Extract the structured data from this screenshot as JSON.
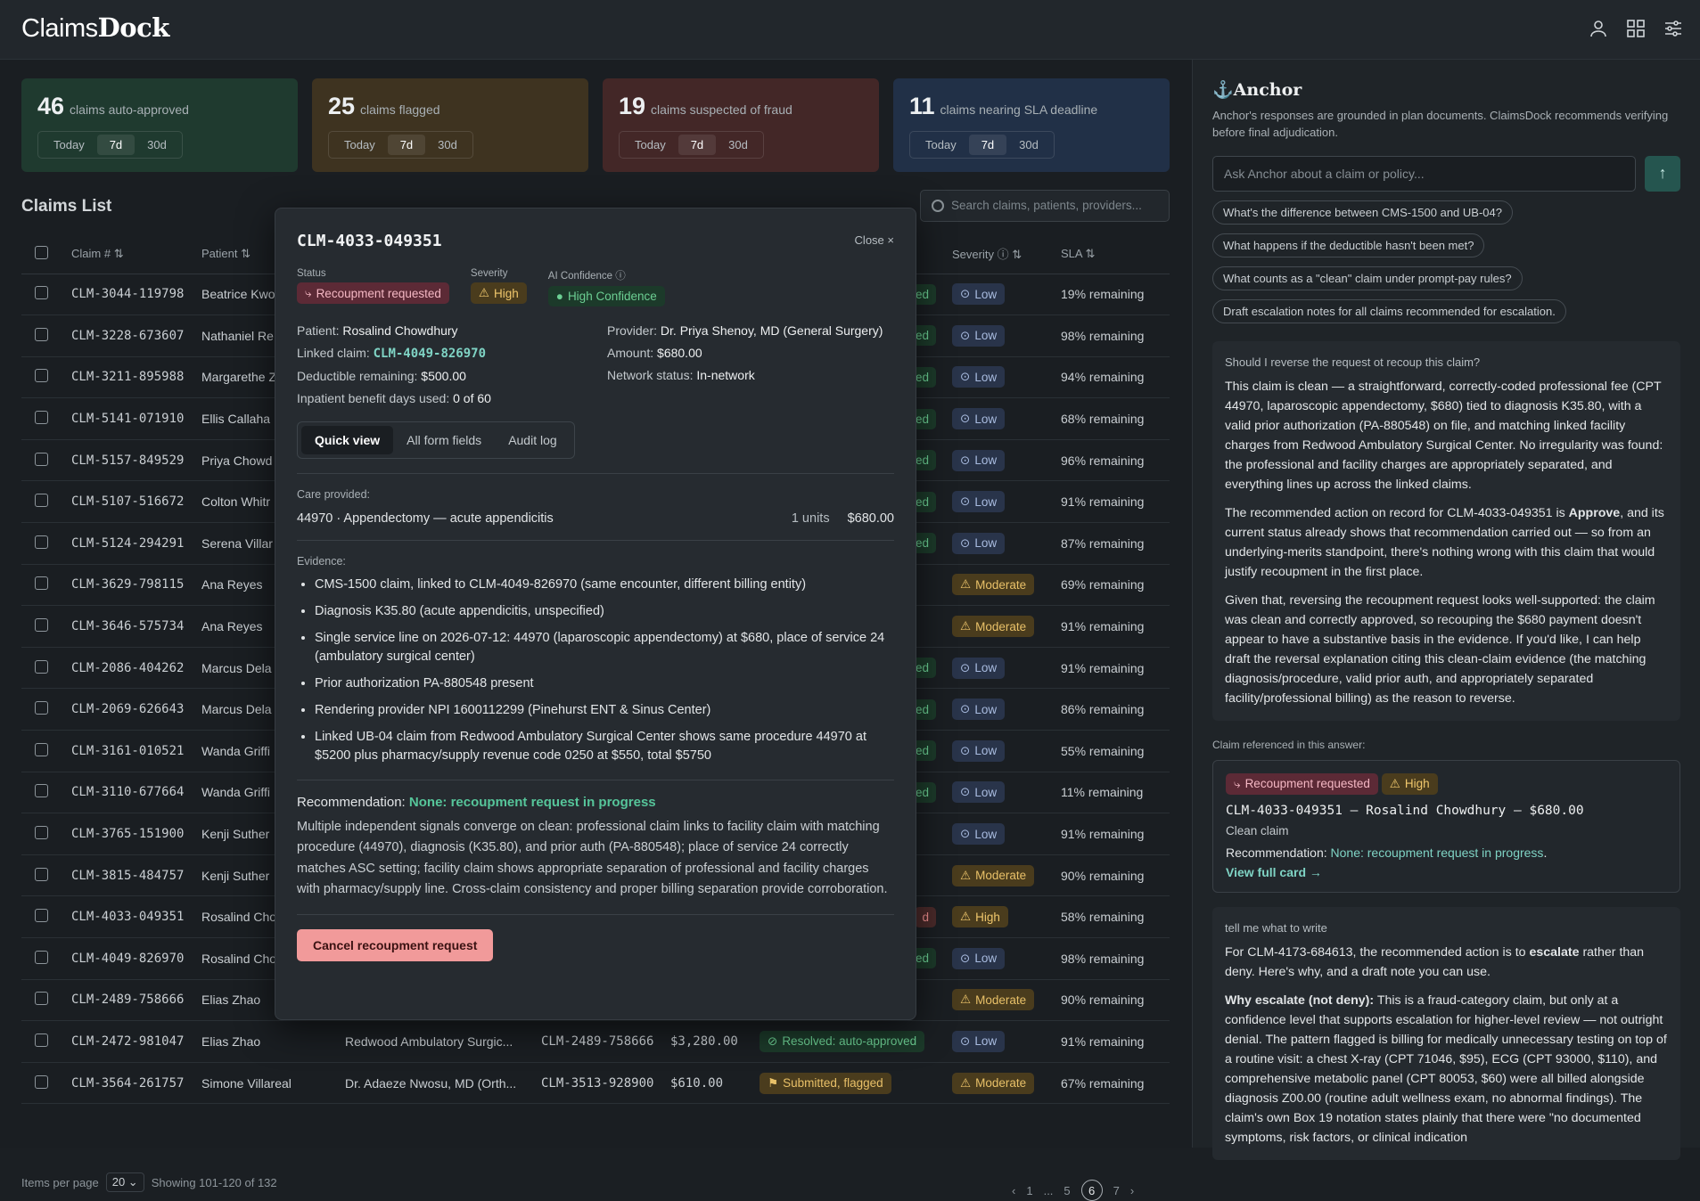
{
  "app": {
    "brand_light": "Claims",
    "brand_bold": "Dock"
  },
  "cards": [
    {
      "num": "46",
      "label": "claims auto-approved",
      "seg": [
        "Today",
        "7d",
        "30d"
      ]
    },
    {
      "num": "25",
      "label": "claims flagged",
      "seg": [
        "Today",
        "7d",
        "30d"
      ]
    },
    {
      "num": "19",
      "label": "claims suspected of fraud",
      "seg": [
        "Today",
        "7d",
        "30d"
      ]
    },
    {
      "num": "11",
      "label": "claims nearing SLA deadline",
      "seg": [
        "Today",
        "7d",
        "30d"
      ]
    }
  ],
  "list": {
    "title": "Claims List",
    "search_placeholder": "Search claims, patients, providers...",
    "headers": {
      "claim": "Claim #",
      "patient": "Patient",
      "severity": "Severity",
      "sla": "SLA"
    },
    "rows": [
      {
        "id": "CLM-3044-119798",
        "patient": "Beatrice Kwo",
        "status": "ed",
        "sev": "Low",
        "sla": "19% remaining"
      },
      {
        "id": "CLM-3228-673607",
        "patient": "Nathaniel Re",
        "status": "ed",
        "sev": "Low",
        "sla": "98% remaining"
      },
      {
        "id": "CLM-3211-895988",
        "patient": "Margarethe Z",
        "status": "ed",
        "sev": "Low",
        "sla": "94% remaining"
      },
      {
        "id": "CLM-5141-071910",
        "patient": "Ellis Callaha",
        "status": "ed",
        "sev": "Low",
        "sla": "68% remaining"
      },
      {
        "id": "CLM-5157-849529",
        "patient": "Priya Chowd",
        "status": "ed",
        "sev": "Low",
        "sla": "96% remaining"
      },
      {
        "id": "CLM-5107-516672",
        "patient": "Colton Whitr",
        "status": "ed",
        "sev": "Low",
        "sla": "91% remaining"
      },
      {
        "id": "CLM-5124-294291",
        "patient": "Serena Villar",
        "status": "ed",
        "sev": "Low",
        "sla": "87% remaining"
      },
      {
        "id": "CLM-3629-798115",
        "patient": "Ana Reyes",
        "status": "",
        "sev": "Moderate",
        "sla": "69% remaining"
      },
      {
        "id": "CLM-3646-575734",
        "patient": "Ana Reyes",
        "status": "",
        "sev": "Moderate",
        "sla": "91% remaining"
      },
      {
        "id": "CLM-2086-404262",
        "patient": "Marcus Dela",
        "status": "ed",
        "sev": "Low",
        "sla": "91% remaining"
      },
      {
        "id": "CLM-2069-626643",
        "patient": "Marcus Dela",
        "status": "ed",
        "sev": "Low",
        "sla": "86% remaining"
      },
      {
        "id": "CLM-3161-010521",
        "patient": "Wanda Griffi",
        "status": "ed",
        "sev": "Low",
        "sla": "55% remaining"
      },
      {
        "id": "CLM-3110-677664",
        "patient": "Wanda Griffi",
        "status": "ed",
        "sev": "Low",
        "sla": "11% remaining"
      },
      {
        "id": "CLM-3765-151900",
        "patient": "Kenji Suther",
        "status": "",
        "sev": "Low",
        "sla": "91% remaining"
      },
      {
        "id": "CLM-3815-484757",
        "patient": "Kenji Suther",
        "status": "",
        "sev": "Moderate",
        "sla": "90% remaining"
      },
      {
        "id": "CLM-4033-049351",
        "patient": "Rosalind Cho",
        "status": "d",
        "sev": "High",
        "sla": "58% remaining"
      },
      {
        "id": "CLM-4049-826970",
        "patient": "Rosalind Cho",
        "status": "ed",
        "sev": "Low",
        "sla": "98% remaining"
      },
      {
        "id": "CLM-2489-758666",
        "patient": "Elias Zhao",
        "status": "",
        "sev": "Moderate",
        "sla": "90% remaining"
      }
    ],
    "full_rows": [
      {
        "id": "CLM-2472-981047",
        "patient": "Elias Zhao",
        "provider": "Redwood Ambulatory Surgic...",
        "linked": "CLM-2489-758666",
        "amount": "$3,280.00",
        "status": "Resolved: auto-approved",
        "sev": "Low",
        "sla": "91% remaining"
      },
      {
        "id": "CLM-3564-261757",
        "patient": "Simone Villareal",
        "provider": "Dr. Adaeze Nwosu, MD (Orth...",
        "linked": "CLM-3513-928900",
        "amount": "$610.00",
        "status": "Submitted, flagged",
        "sev": "Moderate",
        "sla": "67% remaining"
      }
    ],
    "footer": {
      "items_per_page": "Items per page",
      "ipp_value": "20",
      "showing": "Showing 101-120 of 132"
    },
    "pager": [
      "1",
      "...",
      "5",
      "6",
      "7"
    ]
  },
  "modal": {
    "title": "CLM-4033-049351",
    "close": "Close ×",
    "status_label": "Status",
    "status": "Recoupment requested",
    "severity_label": "Severity",
    "severity": "High",
    "conf_label": "AI Confidence",
    "conf": "High Confidence",
    "patient_k": "Patient:",
    "patient_v": "Rosalind Chowdhury",
    "linked_k": "Linked claim:",
    "linked_v": "CLM-4049-826970",
    "deduct_k": "Deductible remaining:",
    "deduct_v": "$500.00",
    "inpat_k": "Inpatient benefit days used:",
    "inpat_v": "0 of 60",
    "provider_k": "Provider:",
    "provider_v": "Dr. Priya Shenoy, MD (General Surgery)",
    "amount_k": "Amount:",
    "amount_v": "$680.00",
    "network_k": "Network status:",
    "network_v": "In-network",
    "tabs": [
      "Quick view",
      "All form fields",
      "Audit log"
    ],
    "care_label": "Care provided:",
    "care_item": "44970 · Appendectomy — acute appendicitis",
    "care_units": "1 units",
    "care_amount": "$680.00",
    "evidence_label": "Evidence:",
    "evidence": [
      "CMS-1500 claim, linked to CLM-4049-826970 (same encounter, different billing entity)",
      "Diagnosis K35.80 (acute appendicitis, unspecified)",
      "Single service line on 2026-07-12: 44970 (laparoscopic appendectomy) at $680, place of service 24 (ambulatory surgical center)",
      "Prior authorization PA-880548 present",
      "Rendering provider NPI 1600112299 (Pinehurst ENT & Sinus Center)",
      "Linked UB-04 claim from Redwood Ambulatory Surgical Center shows same procedure 44970 at $5200 plus pharmacy/supply revenue code 0250 at $550, total $5750"
    ],
    "reco_label": "Recommendation:",
    "reco_value": "None: recoupment request in progress",
    "reco_text": "Multiple independent signals converge on clean: professional claim links to facility claim with matching procedure (44970), diagnosis (K35.80), and prior auth (PA-880548); place of service 24 correctly matches ASC setting; facility claim shows appropriate separation of professional and facility charges with pharmacy/supply line. Cross-claim consistency and proper billing separation provide corroboration.",
    "button": "Cancel recoupment request"
  },
  "side": {
    "title": "Anchor",
    "subtitle": "Anchor's responses are grounded in plan documents. ClaimsDock recommends verifying before final adjudication.",
    "ask_placeholder": "Ask Anchor about a claim or policy...",
    "chips": [
      "What's the difference between CMS-1500 and UB-04?",
      "What happens if the deductible hasn't been met?",
      "What counts as a \"clean\" claim under prompt-pay rules?",
      "Draft escalation notes for all claims recommended for escalation."
    ],
    "q1": "Should I reverse the request ot recoup this claim?",
    "a1p1": "This claim is clean — a straightforward, correctly-coded professional fee (CPT 44970, laparoscopic appendectomy, $680) tied to diagnosis K35.80, with a valid prior authorization (PA-880548) on file, and matching linked facility charges from Redwood Ambulatory Surgical Center. No irregularity was found: the professional and facility charges are appropriately separated, and everything lines up across the linked claims.",
    "a1p2a": "The recommended action on record for CLM-4033-049351 is ",
    "a1p2b": "Approve",
    "a1p2c": ", and its current status already shows that recommendation carried out — so from an underlying-merits standpoint, there's nothing wrong with this claim that would justify recoupment in the first place.",
    "a1p3": "Given that, reversing the recoupment request looks well-supported: the claim was clean and correctly approved, so recouping the $680 payment doesn't appear to have a substantive basis in the evidence. If you'd like, I can help draft the reversal explanation citing this clean-claim evidence (the matching diagnosis/procedure, valid prior auth, and appropriately separated facility/professional billing) as the reason to reverse.",
    "ref_label": "Claim referenced in this answer:",
    "ref_status": "Recoupment requested",
    "ref_sev": "High",
    "ref_line": "CLM-4033-049351 — Rosalind Chowdhury — $680.00",
    "ref_clean": "Clean claim",
    "ref_reco_k": "Recommendation:",
    "ref_reco_v": "None: recoupment request in progress",
    "ref_link": "View full card →",
    "q2": "tell me what to write",
    "a2p1a": "For CLM-4173-684613, the recommended action is to ",
    "a2p1b": "escalate",
    "a2p1c": " rather than deny. Here's why, and a draft note you can use.",
    "a2p2a": "Why escalate (not deny):",
    "a2p2b": " This is a fraud-category claim, but only at a confidence level that supports escalation for higher-level review — not outright denial. The pattern flagged is billing for medically unnecessary testing on top of a routine visit: a chest X-ray (CPT 71046, $95), ECG (CPT 93000, $110), and comprehensive metabolic panel (CPT 80053, $60) were all billed alongside diagnosis Z00.00 (routine adult wellness exam, no abnormal findings). The claim's own Box 19 notation states plainly that there were \"no documented symptoms, risk factors, or clinical indication"
  },
  "colors": {
    "accent": "#7fd3c4",
    "high": "#f0c76c",
    "low": "#a9bce0",
    "danger": "#f19a9a"
  }
}
